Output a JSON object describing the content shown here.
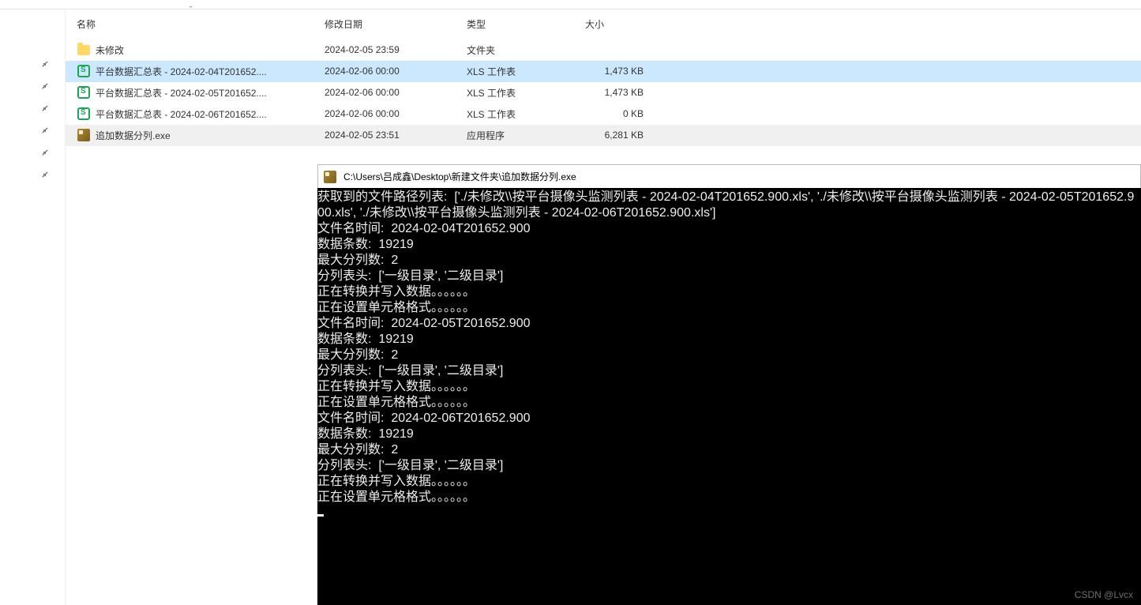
{
  "columns": {
    "name": "名称",
    "date": "修改日期",
    "type": "类型",
    "size": "大小"
  },
  "files": [
    {
      "icon": "folder",
      "name": "未修改",
      "date": "2024-02-05 23:59",
      "type": "文件夹",
      "size": "",
      "sel": false,
      "hl": false
    },
    {
      "icon": "xls",
      "name": "平台数据汇总表 - 2024-02-04T201652....",
      "date": "2024-02-06 00:00",
      "type": "XLS 工作表",
      "size": "1,473 KB",
      "sel": true,
      "hl": false
    },
    {
      "icon": "xls",
      "name": "平台数据汇总表 - 2024-02-05T201652....",
      "date": "2024-02-06 00:00",
      "type": "XLS 工作表",
      "size": "1,473 KB",
      "sel": false,
      "hl": false
    },
    {
      "icon": "xls",
      "name": "平台数据汇总表 - 2024-02-06T201652....",
      "date": "2024-02-06 00:00",
      "type": "XLS 工作表",
      "size": "0 KB",
      "sel": false,
      "hl": false
    },
    {
      "icon": "exe",
      "name": "追加数据分列.exe",
      "date": "2024-02-05 23:51",
      "type": "应用程序",
      "size": "6,281 KB",
      "sel": false,
      "hl": true
    }
  ],
  "console": {
    "title": "C:\\Users\\吕成鑫\\Desktop\\新建文件夹\\追加数据分列.exe",
    "lines": [
      "获取到的文件路径列表:  ['./未修改\\\\按平台摄像头监测列表 - 2024-02-04T201652.900.xls', './未修改\\\\按平台摄像头监测列表 - 2024-02-05T201652.900.xls', './未修改\\\\按平台摄像头监测列表 - 2024-02-06T201652.900.xls']",
      "文件名时间:  2024-02-04T201652.900",
      "数据条数:  19219",
      "最大分列数:  2",
      "分列表头:  ['一级目录', '二级目录']",
      "正在转换并写入数据。。。。。。",
      "正在设置单元格格式。。。。。。",
      "文件名时间:  2024-02-05T201652.900",
      "数据条数:  19219",
      "最大分列数:  2",
      "分列表头:  ['一级目录', '二级目录']",
      "正在转换并写入数据。。。。。。",
      "正在设置单元格格式。。。。。。",
      "文件名时间:  2024-02-06T201652.900",
      "数据条数:  19219",
      "最大分列数:  2",
      "分列表头:  ['一级目录', '二级目录']",
      "正在转换并写入数据。。。。。。",
      "正在设置单元格格式。。。。。。"
    ]
  },
  "watermark": "CSDN @Lvcx"
}
